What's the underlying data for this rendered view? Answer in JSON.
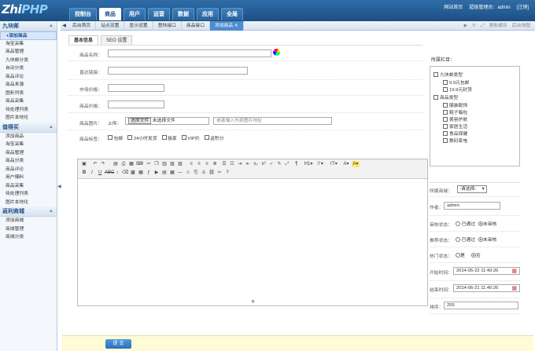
{
  "header": {
    "logo_main": "Zhi",
    "logo_accent": "PHP",
    "nav": [
      "控制台",
      "商品",
      "用户",
      "运营",
      "数据",
      "应用",
      "全局"
    ],
    "active_nav": 1,
    "links": [
      "网站首页",
      "超级管理员：admin",
      "[注销]"
    ]
  },
  "sidebar": {
    "sections": [
      {
        "title": "九块邮",
        "items": [
          "+添加商品",
          "淘宝采集",
          "商品管理",
          "九块邮分类",
          "自动分类",
          "商品评论",
          "商品来源",
          "图析列表",
          "商品采集",
          "待处理列表",
          "图片本地化"
        ]
      },
      {
        "title": "值得买",
        "items": [
          "添加商品",
          "淘宝采集",
          "商品管理",
          "商品分类",
          "商品评论",
          "用户爆料",
          "商品采集",
          "待处理列表",
          "图片本地化"
        ]
      },
      {
        "title": "返利商城",
        "items": [
          "添加商城",
          "商城管理",
          "商城分类"
        ]
      }
    ]
  },
  "tabbar": {
    "tabs": [
      "后台首页",
      "站点设置",
      "显示设置",
      "登陆接口",
      "商品接口",
      "添加商品"
    ],
    "active": 5,
    "right": [
      "更新缓存",
      "后台地图"
    ]
  },
  "inner_tabs": [
    "基本信息",
    "SEO 设置"
  ],
  "form": {
    "title_label": "商品名称：",
    "link_label": "直达链接：",
    "market_price_label": "市场价格：",
    "price_label": "商品价格：",
    "image_label": "商品图片：",
    "upload_label": "上传：",
    "file_button": "选择文件",
    "file_none": "未选择文件",
    "image_url_placeholder": "或者输入外部图片地址",
    "tags_label": "商品标签：",
    "tags": [
      "包邮",
      "24小时发货",
      "独享",
      "VIP价",
      "返积分"
    ]
  },
  "category_panel": {
    "title": "所属栏目：",
    "groups": [
      {
        "name": "九块邮类型",
        "children": [
          "9.9元包邮",
          "19.9元封顶"
        ]
      },
      {
        "name": "商品类型",
        "children": [
          "服装配饰",
          "鞋子箱包",
          "美容护肤",
          "家居生活",
          "食品保健",
          "数码家电"
        ]
      }
    ]
  },
  "side_form": {
    "mall_label": "所属商城：",
    "mall_value": "-请选择-",
    "author_label": "作者：",
    "author_value": "admin",
    "review_label": "审核状态：",
    "review_options": [
      "已通过",
      "未审核"
    ],
    "recommend_label": "推荐状态：",
    "recommend_options": [
      "已通过",
      "未审核"
    ],
    "hot_label": "热门状态：",
    "hot_options": [
      "是",
      "否"
    ],
    "start_label": "开始时间：",
    "start_value": "2014-05-22 11:40:26",
    "end_label": "结束时间：",
    "end_value": "2014-06-21 11:40:26",
    "sort_label": "排序：",
    "sort_value": "255"
  },
  "footer": {
    "submit": "提 交"
  },
  "colors": {
    "topbar": "#1c4f84",
    "active_tab": "#4d8cd0",
    "footer": "#fffbd6"
  }
}
